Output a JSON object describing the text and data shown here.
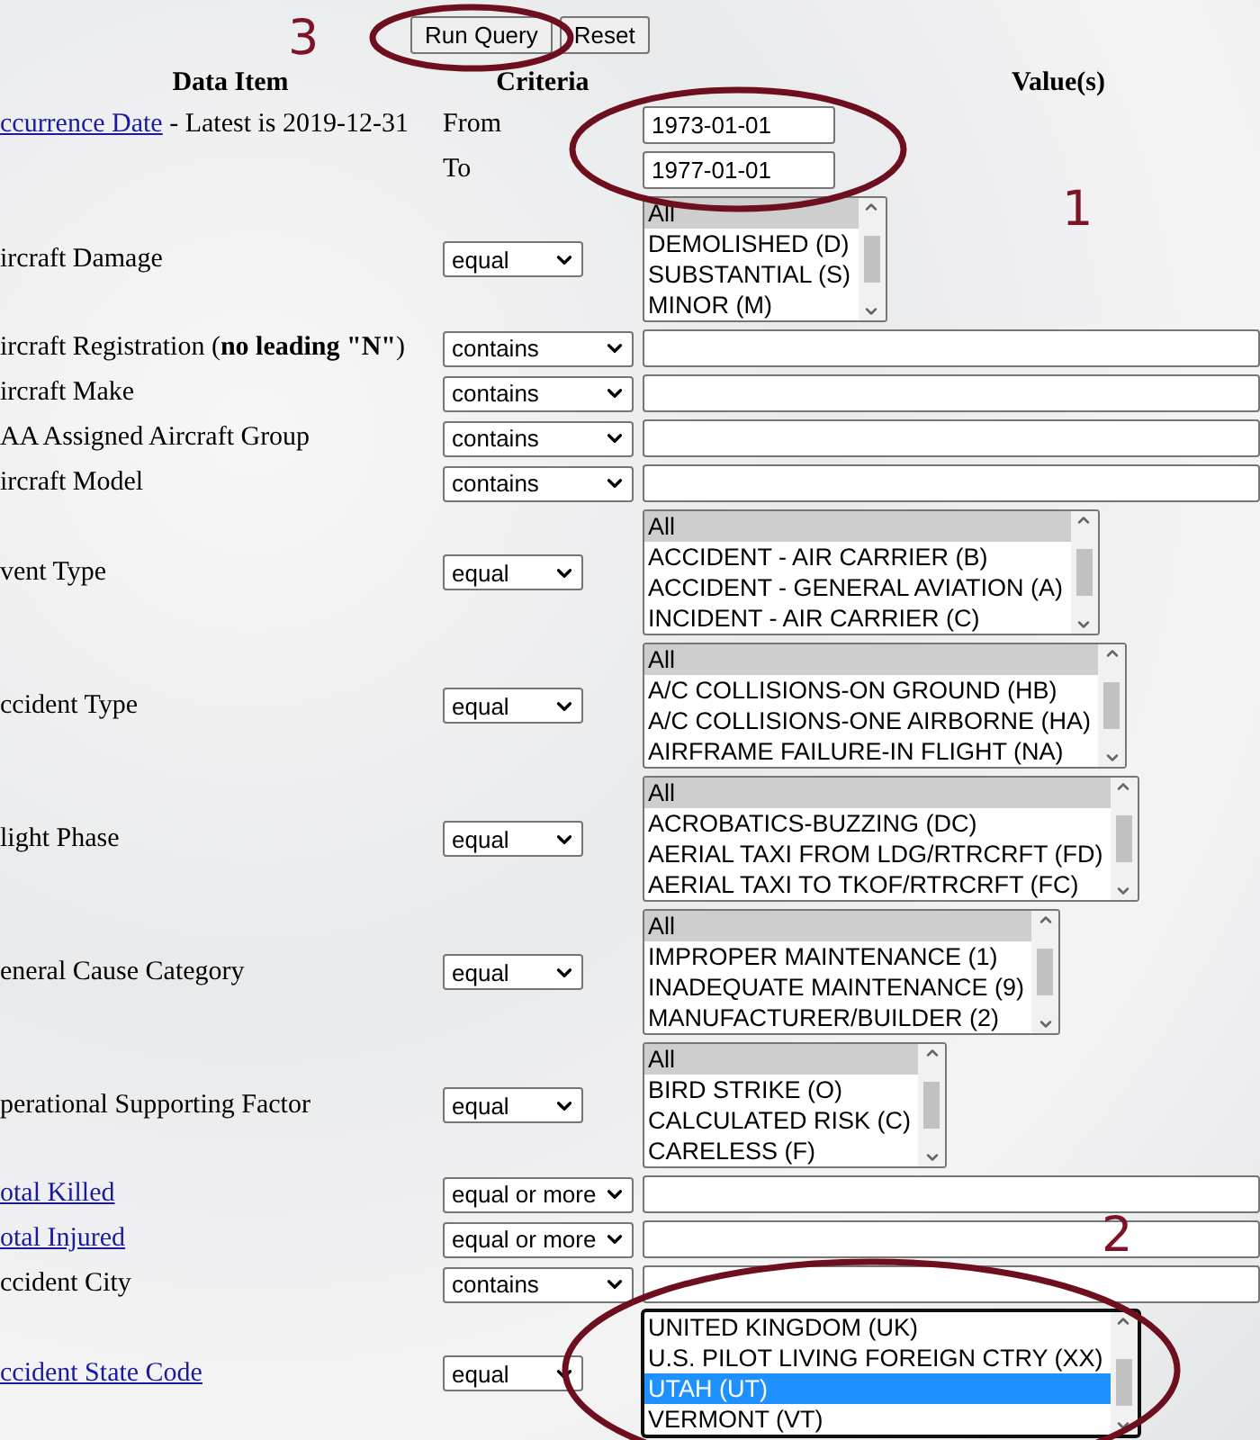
{
  "buttons": [
    {
      "label": "Run Query"
    },
    {
      "label": "Reset"
    }
  ],
  "headers": [
    "Data Item",
    "Criteria",
    "Value(s)"
  ],
  "rows": [
    {
      "kind": "date",
      "link": "ccurrence Date",
      "text": " - Latest is 2019-12-31",
      "from_label": "From",
      "from_value": "1973-01-01",
      "to_label": "To",
      "to_value": "1977-01-01"
    },
    {
      "kind": "list",
      "label": "ircraft Damage",
      "is_link": false,
      "operator": "equal",
      "focused": false,
      "scrolled": false,
      "options": [
        {
          "text": "All",
          "selected": true
        },
        {
          "text": "DEMOLISHED (D)",
          "selected": false
        },
        {
          "text": "SUBSTANTIAL (S)",
          "selected": false
        },
        {
          "text": "MINOR (M)",
          "selected": false
        }
      ]
    },
    {
      "kind": "text",
      "label": "ircraft Registration (**no leading \"N\"**)",
      "is_link": false,
      "operator": "contains"
    },
    {
      "kind": "text",
      "label": "ircraft Make",
      "is_link": false,
      "operator": "contains"
    },
    {
      "kind": "text",
      "label": "AA Assigned Aircraft Group",
      "is_link": false,
      "operator": "contains"
    },
    {
      "kind": "text",
      "label": "ircraft Model",
      "is_link": false,
      "operator": "contains"
    },
    {
      "kind": "list",
      "label": "vent Type",
      "is_link": false,
      "operator": "equal",
      "focused": false,
      "scrolled": false,
      "options": [
        {
          "text": "All",
          "selected": true
        },
        {
          "text": "ACCIDENT - AIR CARRIER (B)",
          "selected": false
        },
        {
          "text": "ACCIDENT - GENERAL AVIATION (A)",
          "selected": false
        },
        {
          "text": "INCIDENT - AIR CARRIER (C)",
          "selected": false
        }
      ]
    },
    {
      "kind": "list",
      "label": "ccident Type",
      "is_link": false,
      "operator": "equal",
      "focused": false,
      "scrolled": false,
      "options": [
        {
          "text": "All",
          "selected": true
        },
        {
          "text": "A/C COLLISIONS-ON GROUND (HB)",
          "selected": false
        },
        {
          "text": "A/C COLLISIONS-ONE AIRBORNE (HA)",
          "selected": false
        },
        {
          "text": "AIRFRAME FAILURE-IN FLIGHT (NA)",
          "selected": false
        }
      ]
    },
    {
      "kind": "list",
      "label": "light Phase",
      "is_link": false,
      "operator": "equal",
      "focused": false,
      "scrolled": false,
      "options": [
        {
          "text": "All",
          "selected": true
        },
        {
          "text": "ACROBATICS-BUZZING (DC)",
          "selected": false
        },
        {
          "text": "AERIAL TAXI FROM LDG/RTRCRFT (FD)",
          "selected": false
        },
        {
          "text": "AERIAL TAXI TO TKOF/RTRCRFT (FC)",
          "selected": false
        }
      ]
    },
    {
      "kind": "list",
      "label": "eneral Cause Category",
      "is_link": false,
      "operator": "equal",
      "focused": false,
      "scrolled": false,
      "options": [
        {
          "text": "All",
          "selected": true
        },
        {
          "text": "IMPROPER MAINTENANCE (1)",
          "selected": false
        },
        {
          "text": "INADEQUATE MAINTENANCE (9)",
          "selected": false
        },
        {
          "text": "MANUFACTURER/BUILDER (2)",
          "selected": false
        }
      ]
    },
    {
      "kind": "list",
      "label": "perational Supporting Factor",
      "is_link": false,
      "operator": "equal",
      "focused": false,
      "scrolled": false,
      "options": [
        {
          "text": "All",
          "selected": true
        },
        {
          "text": "BIRD STRIKE (O)",
          "selected": false
        },
        {
          "text": "CALCULATED RISK (C)",
          "selected": false
        },
        {
          "text": "CARELESS (F)",
          "selected": false
        }
      ]
    },
    {
      "kind": "text",
      "label": "otal Killed",
      "is_link": true,
      "operator": "equal or more"
    },
    {
      "kind": "text",
      "label": "otal Injured",
      "is_link": true,
      "operator": "equal or more"
    },
    {
      "kind": "text",
      "label": "ccident City",
      "is_link": false,
      "operator": "contains"
    },
    {
      "kind": "list",
      "label": "ccident State Code",
      "is_link": true,
      "operator": "equal",
      "focused": true,
      "scrolled": true,
      "options": [
        {
          "text": "UNITED KINGDOM (UK)",
          "selected": false
        },
        {
          "text": "U.S. PILOT LIVING FOREIGN CTRY (XX)",
          "selected": false
        },
        {
          "text": "UTAH (UT)",
          "selected": true
        },
        {
          "text": "VERMONT (VT)",
          "selected": false
        }
      ]
    }
  ],
  "annotations": [
    {
      "label": "3"
    },
    {
      "label": "1"
    },
    {
      "label": "2"
    }
  ]
}
